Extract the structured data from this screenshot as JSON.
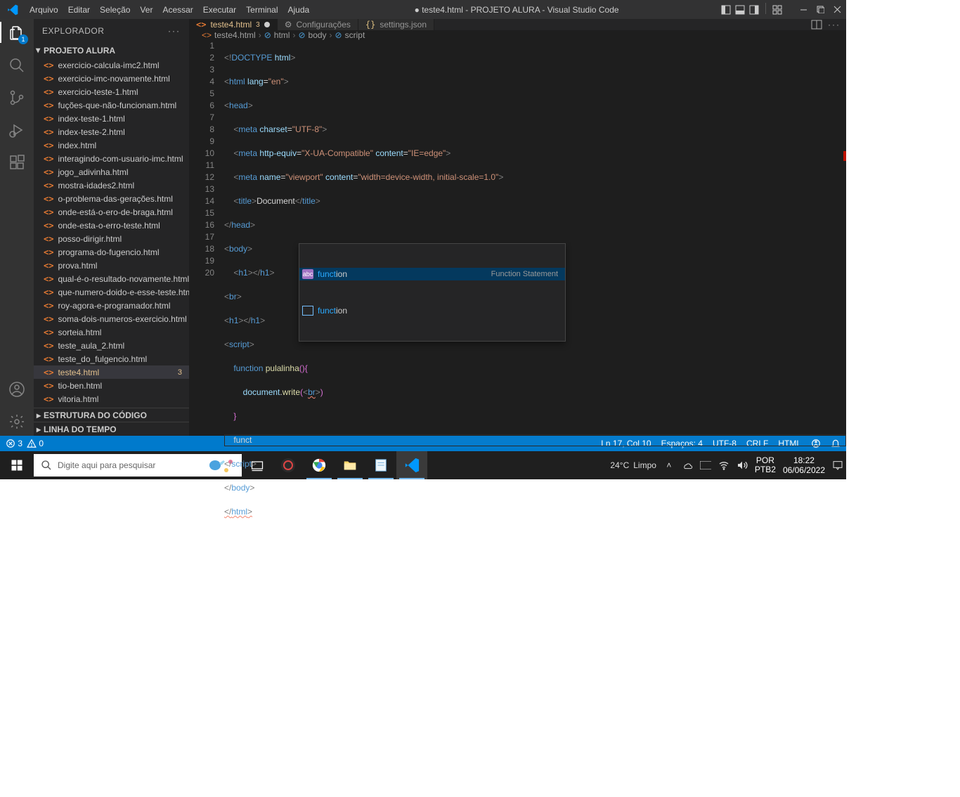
{
  "window_title": "● teste4.html - PROJETO ALURA - Visual Studio Code",
  "menu": [
    "Arquivo",
    "Editar",
    "Seleção",
    "Ver",
    "Acessar",
    "Executar",
    "Terminal",
    "Ajuda"
  ],
  "explorer_label": "EXPLORADOR",
  "project_name": "PROJETO ALURA",
  "activity_badge": "1",
  "files": [
    "exercicio-calcula-imc2.html",
    "exercicio-imc-novamente.html",
    "exercicio-teste-1.html",
    "fuções-que-não-funcionam.html",
    "index-teste-1.html",
    "index-teste-2.html",
    "index.html",
    "interagindo-com-usuario-imc.html",
    "jogo_adivinha.html",
    "mostra-idades2.html",
    "o-problema-das-gerações.html",
    "onde-está-o-ero-de-braga.html",
    "onde-esta-o-erro-teste.html",
    "posso-dirigir.html",
    "programa-do-fugencio.html",
    "prova.html",
    "qual-é-o-resultado-novamente.html",
    "que-numero-doido-e-esse-teste.html",
    "roy-agora-e-programador.html",
    "soma-dois-numeros-exercicio.html",
    "sorteia.html",
    "teste_aula_2.html",
    "teste_do_fulgencio.html",
    "teste4.html",
    "tio-ben.html",
    "vitoria.html"
  ],
  "selected_file_index": 23,
  "selected_badge": "3",
  "outline_label": "ESTRUTURA DO CÓDIGO",
  "timeline_label": "LINHA DO TEMPO",
  "tabs": [
    {
      "label": "teste4.html",
      "badge": "3",
      "modified": true,
      "active": true,
      "iconColor": "#e37933"
    },
    {
      "label": "Configurações",
      "icon": "gear",
      "active": false
    },
    {
      "label": "settings.json",
      "icon": "json",
      "active": false
    }
  ],
  "breadcrumbs": [
    "teste4.html",
    "html",
    "body",
    "script"
  ],
  "code_lines": 20,
  "autocomplete": {
    "items": [
      {
        "kind": "abc",
        "prefix": "funct",
        "suffix": "ion",
        "detail": "Function Statement",
        "selected": true
      },
      {
        "kind": "box",
        "prefix": "funct",
        "suffix": "ion",
        "detail": "",
        "selected": false
      }
    ]
  },
  "statusbar": {
    "errors": "3",
    "warnings": "0",
    "position": "Ln 17, Col 10",
    "spaces": "Espaços: 4",
    "encoding": "UTF-8",
    "eol": "CRLF",
    "lang": "HTML"
  },
  "taskbar": {
    "search_placeholder": "Digite aqui para pesquisar",
    "weather_temp": "24°C",
    "weather_desc": "Limpo",
    "lang1": "POR",
    "lang2": "PTB2",
    "time": "18:22",
    "date": "06/06/2022"
  }
}
